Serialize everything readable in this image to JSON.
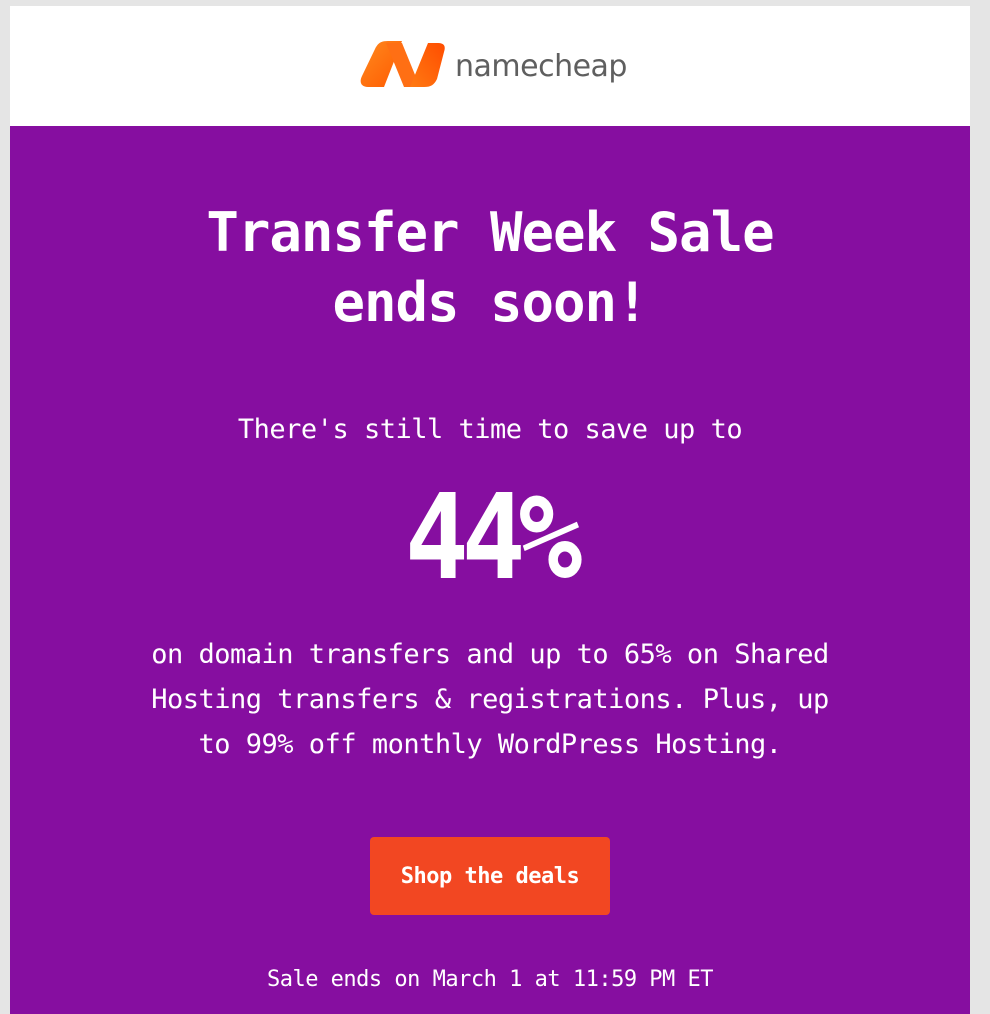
{
  "header": {
    "logo_text": "namecheap",
    "logo_mark": "namecheap-n-logo",
    "background": "#ffffff"
  },
  "hero": {
    "background": "#860ea0",
    "headline_line1": "Transfer Week Sale",
    "headline_line2": "ends soon!",
    "intro": "There's still time to save up to",
    "big_percent": "44%",
    "details": "on domain transfers and up to 65% on Shared Hosting transfers & registrations. Plus, up to 99% off monthly WordPress Hosting.",
    "cta_label": "Shop the deals",
    "cta_color": "#f24722",
    "sale_end": "Sale ends on March 1 at 11:59 PM ET"
  }
}
